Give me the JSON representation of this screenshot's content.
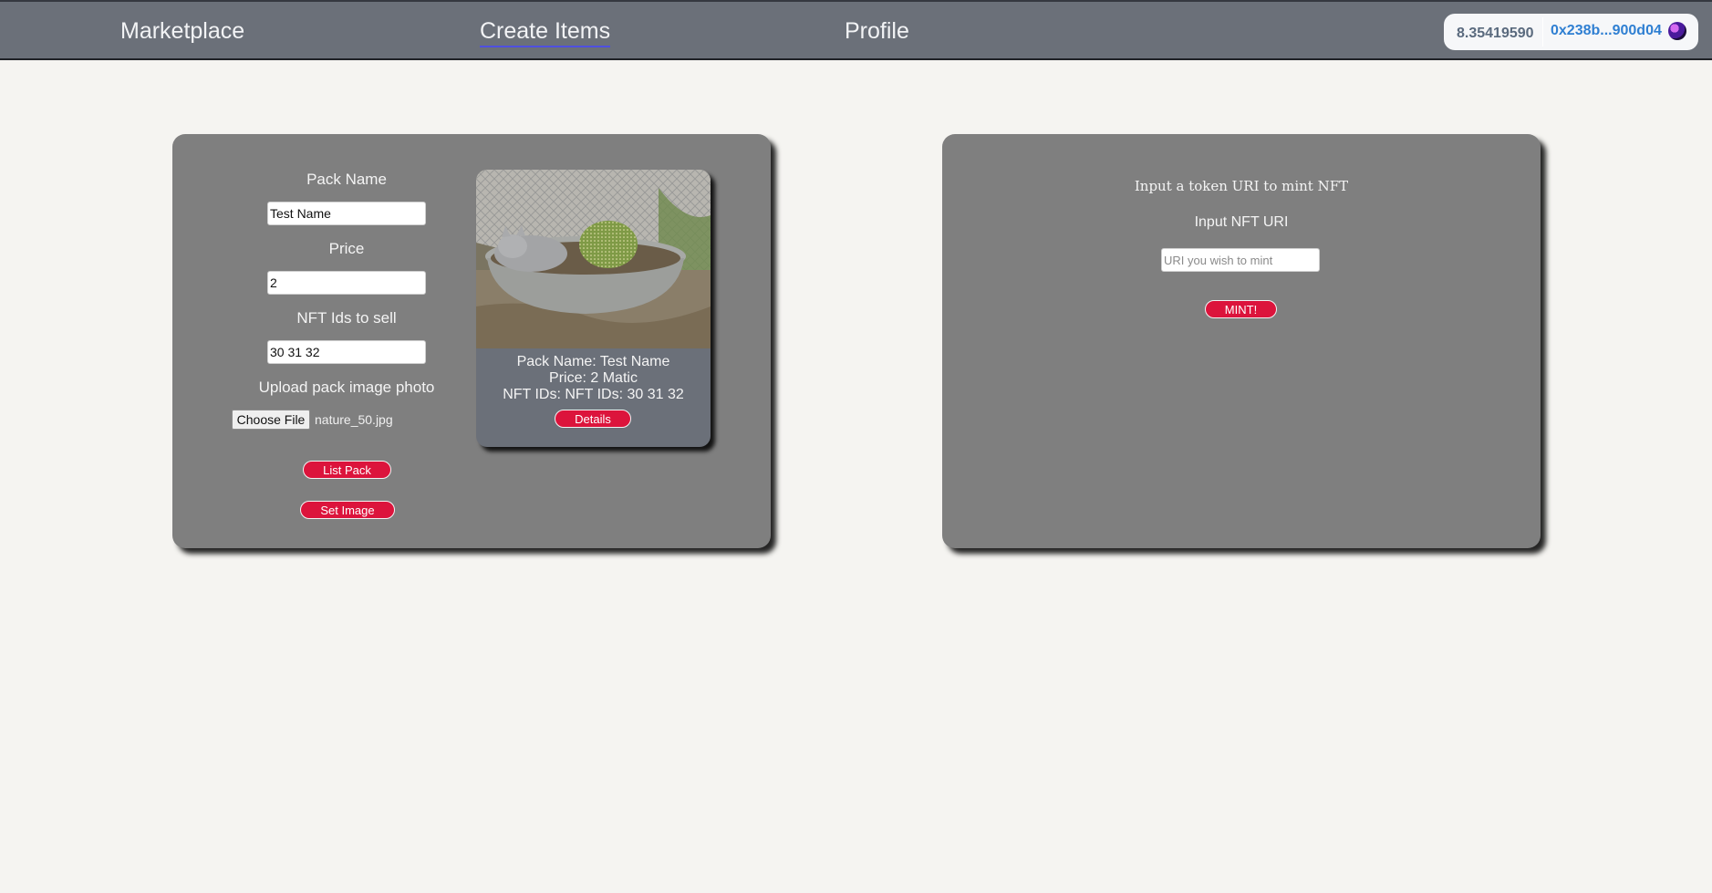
{
  "nav": {
    "items": [
      {
        "label": "Marketplace"
      },
      {
        "label": "Create Items"
      },
      {
        "label": "Profile"
      }
    ],
    "wallet": {
      "balance": "8.35419590",
      "address": "0x238b...900d04",
      "avatar_icon": "wallet-avatar-icon"
    }
  },
  "create_pack": {
    "pack_name_label": "Pack Name",
    "pack_name_value": "Test Name",
    "price_label": "Price",
    "price_value": "2",
    "nft_ids_label": "NFT Ids to sell",
    "nft_ids_value": "30 31 32",
    "upload_label": "Upload pack image photo",
    "choose_file_label": "Choose File",
    "file_name": "nature_50.jpg",
    "list_pack_button": "List Pack",
    "set_image_button": "Set Image"
  },
  "preview_card": {
    "image_alt": "cat-in-planter-photo",
    "pack_name_line": "Pack Name: Test Name",
    "price_line": "Price: 2 Matic",
    "nft_ids_line": "NFT IDs: NFT IDs: 30 31 32",
    "details_button": "Details"
  },
  "mint": {
    "heading": "Input a token URI to mint NFT",
    "input_label": "Input NFT URI",
    "input_placeholder": "URI you wish to mint",
    "mint_button": "MINT!"
  },
  "colors": {
    "nav_bg": "#6b7079",
    "page_bg": "#f5f4f1",
    "panel_bg": "#7f7f7f",
    "accent_button": "#dc143c",
    "wallet_address": "#2f7fd2"
  }
}
